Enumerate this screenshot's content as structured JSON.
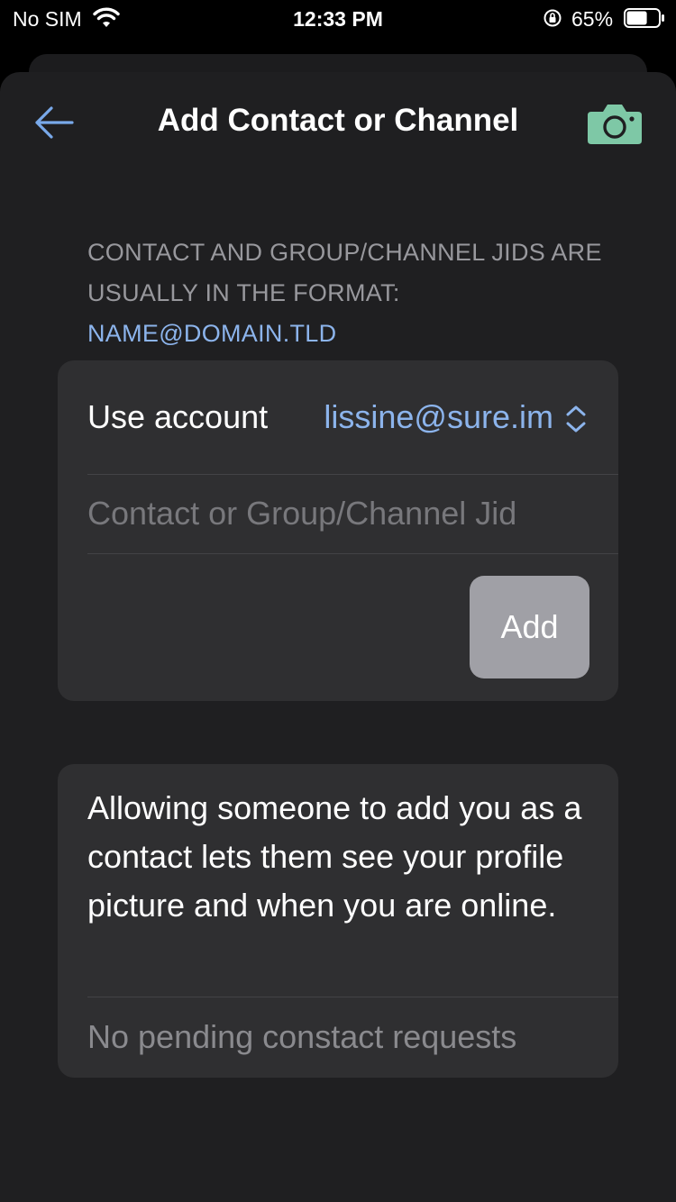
{
  "status_bar": {
    "carrier": "No SIM",
    "time": "12:33 PM",
    "battery_percent": "65%",
    "battery_level": 0.65,
    "icons": [
      "wifi-icon",
      "orientation-lock-icon",
      "battery-icon"
    ]
  },
  "nav": {
    "title": "Add Contact or Channel",
    "back_icon": "arrow-left-icon",
    "camera_icon": "camera-icon"
  },
  "help": {
    "text": "Contact and Group/Channel JIDs are usually in the format:",
    "format_link": "name@domain.tld"
  },
  "form": {
    "account_label": "Use account",
    "account_value": "lissine@sure.im",
    "jid_placeholder": "Contact or Group/Channel Jid",
    "jid_value": "",
    "add_label": "Add"
  },
  "requests": {
    "info": "Allowing someone to add you as a contact lets them see your profile picture and when you are online.",
    "pending": "No pending constact requests"
  },
  "colors": {
    "background": "#000000",
    "sheet": "#1f1f21",
    "card": "#2f2f31",
    "accent_blue": "#8cb4ec",
    "camera_green": "#7ec8a6",
    "secondary_text": "#98989d",
    "disabled_button": "#a0a0a6"
  }
}
